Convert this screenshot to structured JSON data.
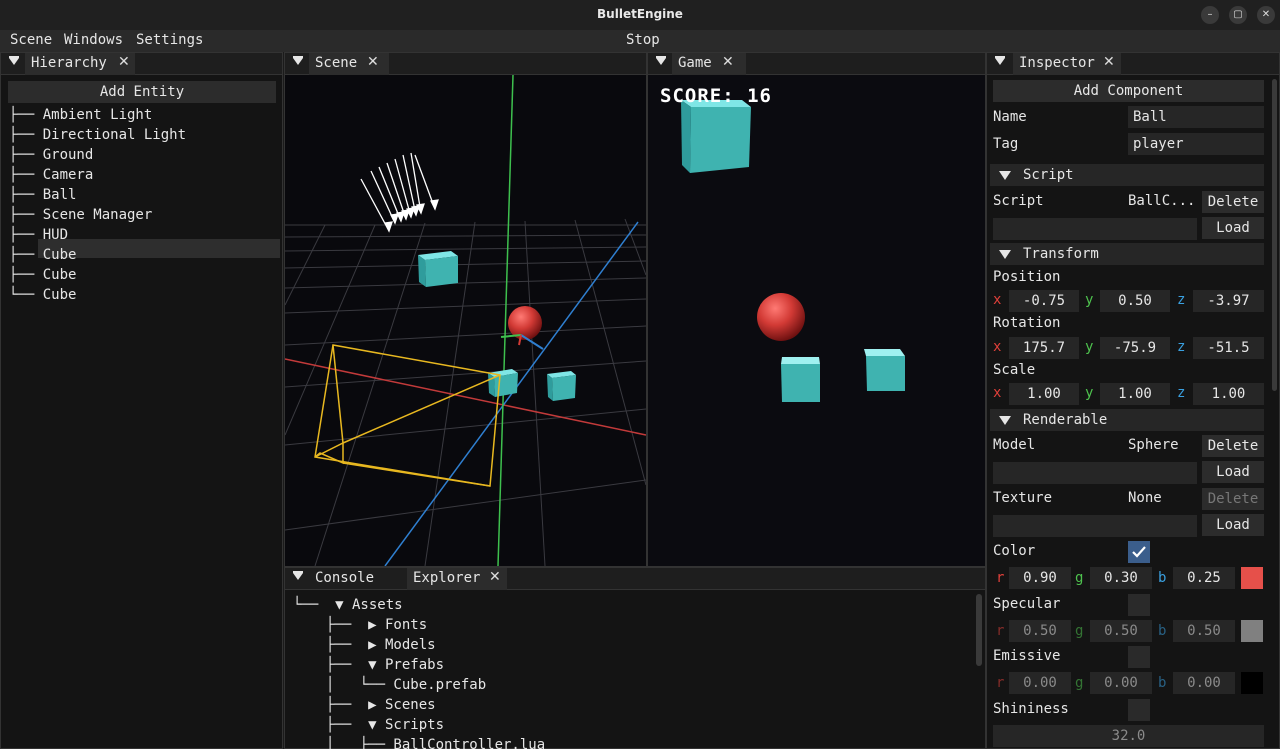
{
  "window": {
    "title": "BulletEngine",
    "buttons": [
      "–",
      "▢",
      "✕"
    ]
  },
  "menu": {
    "items": [
      "Scene",
      "Windows",
      "Settings"
    ],
    "center_action": "Stop"
  },
  "hierarchy": {
    "tab": "Hierarchy",
    "add_button": "Add Entity",
    "items": [
      "├── Ambient Light",
      "├── Directional Light",
      "├── Ground",
      "├── Camera",
      "├── Ball",
      "├── Scene Manager",
      "├── HUD",
      "├── Cube",
      "├── Cube",
      "└── Cube"
    ],
    "selected_index": 4
  },
  "scene": {
    "tab": "Scene"
  },
  "game": {
    "tab": "Game",
    "score_label": "SCORE:",
    "score_value": "16"
  },
  "bottom": {
    "tabs": [
      "Console",
      "Explorer"
    ],
    "active_tab": "Explorer",
    "tree": [
      "└──  ▼ Assets",
      "├──  ▶ Fonts",
      "├──  ▶ Models",
      "├──  ▼ Prefabs",
      "│   └── Cube.prefab",
      "├──  ▶ Scenes",
      "├──  ▼ Scripts",
      "│   ├── BallController.lua"
    ]
  },
  "inspector": {
    "tab": "Inspector",
    "add_component": "Add Component",
    "name_label": "Name",
    "name_value": "Ball",
    "tag_label": "Tag",
    "tag_value": "player",
    "script_section": "Script",
    "script_label": "Script",
    "script_value": "BallC...",
    "delete": "Delete",
    "load": "Load",
    "transform_section": "Transform",
    "position_label": "Position",
    "rotation_label": "Rotation",
    "scale_label": "Scale",
    "axes": [
      "x",
      "y",
      "z"
    ],
    "position": [
      "-0.75",
      "0.50",
      "-3.97"
    ],
    "rotation": [
      "175.7",
      "-75.9",
      "-51.5"
    ],
    "scale": [
      "1.00",
      "1.00",
      "1.00"
    ],
    "renderable_section": "Renderable",
    "model_label": "Model",
    "model_value": "Sphere",
    "texture_label": "Texture",
    "texture_value": "None",
    "color_label": "Color",
    "color_channels": [
      "r",
      "g",
      "b"
    ],
    "color": [
      "0.90",
      "0.30",
      "0.25"
    ],
    "color_hex": "#e6504a",
    "specular_label": "Specular",
    "specular": [
      "0.50",
      "0.50",
      "0.50"
    ],
    "specular_hex": "#808080",
    "emissive_label": "Emissive",
    "emissive": [
      "0.00",
      "0.00",
      "0.00"
    ],
    "emissive_hex": "#000000",
    "shininess_label": "Shininess",
    "shininess": "32.0"
  }
}
